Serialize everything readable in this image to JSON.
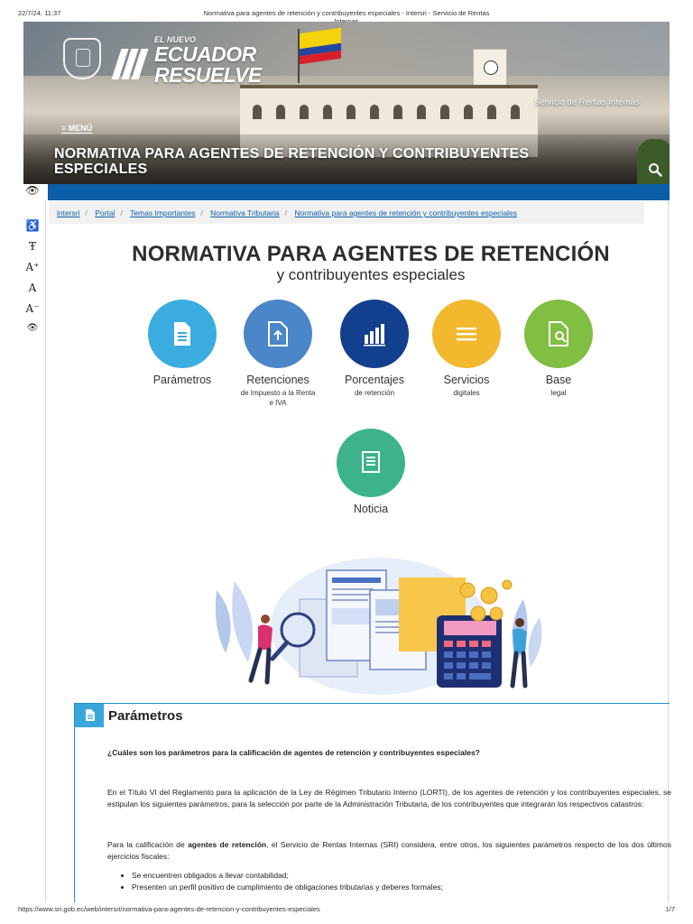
{
  "print": {
    "datetime": "22/7/24, 11:37",
    "title": "Normativa para agentes de retención y contribuyentes especiales - Intersri - Servicio de Rentas Internas",
    "url": "https://www.sri.gob.ec/web/intersri/normativa-para-agentes-de-retencion-y-contribuyentes-especiales",
    "page": "1/7"
  },
  "hero": {
    "logo_small": "EL NUEVO",
    "logo_line1": "ECUADOR",
    "logo_line2": "RESUELVE",
    "agency": "Servicio de Rentas Internas",
    "menu_label": "MENÚ",
    "title": "NORMATIVA PARA AGENTES DE RETENCIÓN Y CONTRIBUYENTES ESPECIALES"
  },
  "accessibility": {
    "glyphs": [
      "👁",
      "♿",
      "Ŧ",
      "A⁺",
      "A",
      "A⁻",
      "👁"
    ]
  },
  "breadcrumb": [
    "intersri",
    "Portal",
    "Temas Importantes",
    "Normativa Tributaria",
    "Normativa para agentes de retención y contribuyentes especiales"
  ],
  "main": {
    "title": "NORMATIVA PARA AGENTES DE RETENCIÓN",
    "subtitle": "y contribuyentes especiales"
  },
  "categories": [
    {
      "label": "Parámetros",
      "sub": "",
      "color": "#3aace0",
      "icon": "document-icon"
    },
    {
      "label": "Retenciones",
      "sub": "de Impuesto a la Renta e IVA",
      "color": "#4a86c8",
      "icon": "file-upload-icon"
    },
    {
      "label": "Porcentajes",
      "sub": "de retención",
      "color": "#123f8e",
      "icon": "bar-chart-icon"
    },
    {
      "label": "Servicios",
      "sub": "digitales",
      "color": "#f2b92e",
      "icon": "list-icon"
    },
    {
      "label": "Base",
      "sub": "legal",
      "color": "#80bf42",
      "icon": "file-search-icon"
    },
    {
      "label": "Noticia",
      "sub": "",
      "color": "#3cb38a",
      "icon": "newspaper-icon"
    }
  ],
  "section": {
    "title": "Parámetros",
    "question": "¿Cuáles son los parámetros para la calificación de agentes de retención y contribuyentes especiales?",
    "p1": "En el Título VI del Reglamento para la aplicación de la Ley de Régimen Tributario Interno (LORTI), de los agentes de retención y los contribuyentes especiales, se estipulan los siguientes parámetros, para la selección por parte de la Administración Tributaria, de los contribuyentes que integrarán los respectivos catastros:",
    "p2_before": "Para la calificación de ",
    "p2_bold": "agentes de retención",
    "p2_after": ", el Servicio de Rentas Internas (SRI) considera, entre otros, los siguientes parámetros respecto de los dos últimos ejercicios fiscales:",
    "bullets": [
      "Se encuentren obligados a llevar contabilidad;",
      "Presenten un perfil positivo de cumplimiento de obligaciones tributarias y deberes formales;"
    ]
  }
}
